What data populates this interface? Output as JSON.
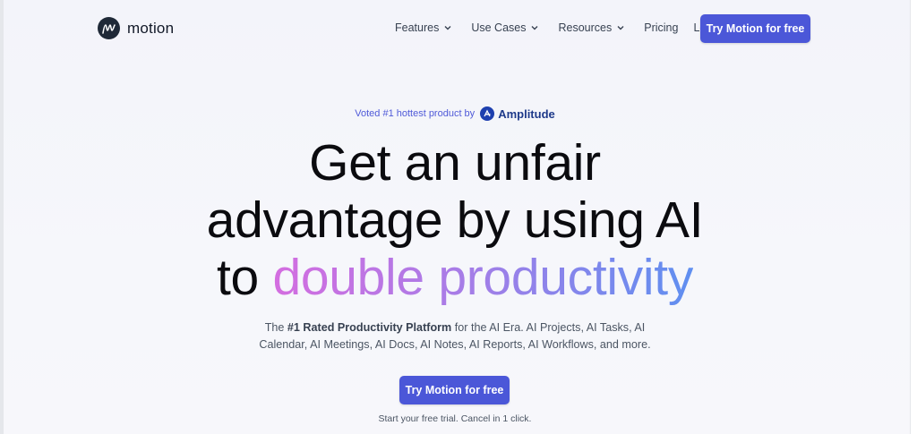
{
  "header": {
    "logo_text": "motion",
    "nav": [
      {
        "label": "Features",
        "has_dropdown": true
      },
      {
        "label": "Use Cases",
        "has_dropdown": true
      },
      {
        "label": "Resources",
        "has_dropdown": true
      },
      {
        "label": "Pricing",
        "has_dropdown": false
      },
      {
        "label": "Login",
        "has_dropdown": false
      }
    ],
    "cta_label": "Try Motion for free"
  },
  "hero": {
    "voted_text": "Voted #1 hottest product by",
    "voted_brand": "Amplitude",
    "headline_line1": "Get an unfair",
    "headline_line2": "advantage by using AI",
    "headline_line3_prefix": "to ",
    "headline_line3_highlight": "double productivity",
    "sub_prefix": "The ",
    "sub_bold": "#1 Rated Productivity Platform",
    "sub_line1_rest": " for the AI Era. AI Projects, AI Tasks, AI",
    "sub_line2": "Calendar, AI Meetings, AI Docs, AI Notes, AI Reports, AI Workflows, and more.",
    "cta_label": "Try Motion for free",
    "trial_text": "Start your free trial. Cancel in 1 click."
  },
  "colors": {
    "accent": "#4b57d8",
    "gradient_start": "#d46de0",
    "gradient_end": "#5f8ff0"
  }
}
